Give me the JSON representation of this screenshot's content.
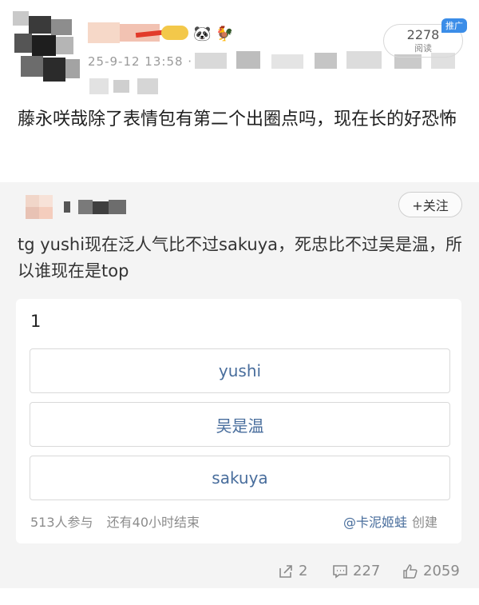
{
  "post": {
    "meta_visible": "25-9-12 13:58 · 超",
    "reads": "2278",
    "reads_label": "阅读",
    "promo_tag": "推广",
    "text": "藤永咲哉除了表情包有第二个出圈点吗，现在长的好恐怖"
  },
  "comment": {
    "follow_label": "+关注",
    "text": "tg yushi现在泛人气比不过sakuya，死忠比不过吴是温，所以谁现在是top"
  },
  "poll": {
    "title": "1",
    "options": [
      "yushi",
      "吴是温",
      "sakuya"
    ],
    "participants": "513人参与",
    "remaining": "还有40小时结束",
    "creator": "@卡泥姬蛙",
    "created_label": "创建"
  },
  "actions": {
    "share_count": "2",
    "comment_count": "227",
    "like_count": "2059"
  },
  "colors": {
    "link": "#486d9c",
    "promo": "#3b8de8",
    "background_band": "#f4f4f4"
  },
  "icons": [
    "share-icon",
    "comment-icon",
    "like-icon",
    "panda-icon",
    "rooster-icon"
  ]
}
